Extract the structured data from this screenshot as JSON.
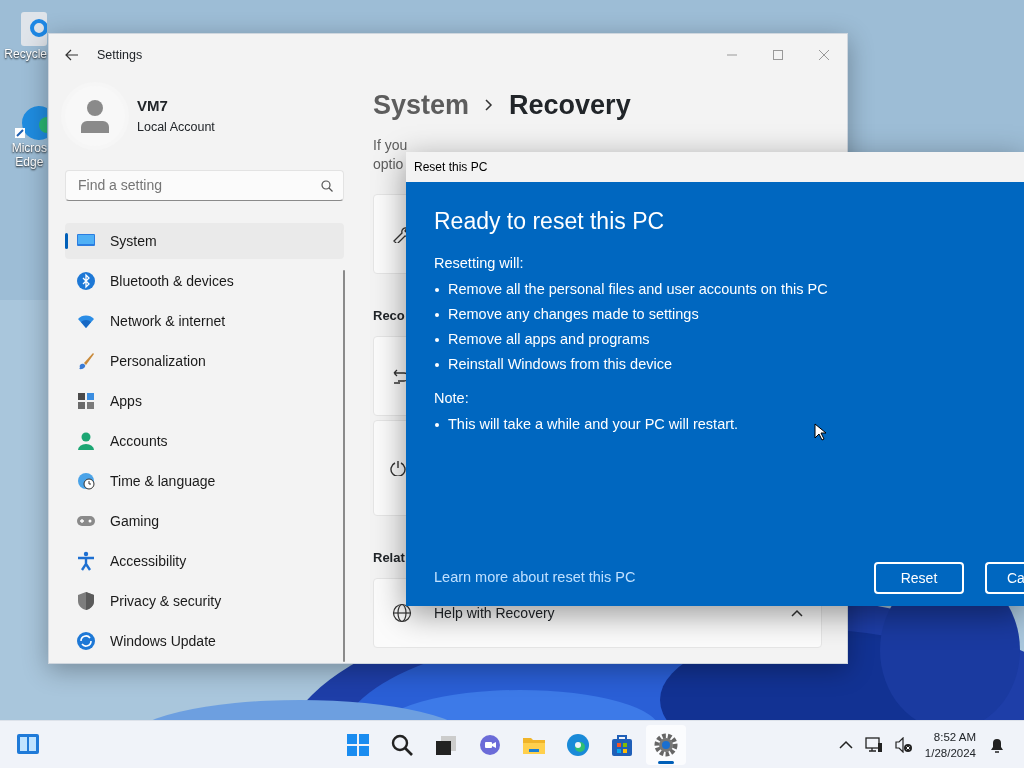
{
  "desktop_icons": [
    {
      "lines": [
        "Recycle"
      ]
    },
    {
      "lines": [
        "Micros",
        "Edge"
      ]
    }
  ],
  "settings_window": {
    "title": "Settings",
    "account": {
      "name": "VM7",
      "type": "Local Account"
    },
    "search": {
      "placeholder": "Find a setting"
    },
    "nav_items": [
      {
        "label": "System",
        "selected": true
      },
      {
        "label": "Bluetooth & devices",
        "selected": false
      },
      {
        "label": "Network & internet",
        "selected": false
      },
      {
        "label": "Personalization",
        "selected": false
      },
      {
        "label": "Apps",
        "selected": false
      },
      {
        "label": "Accounts",
        "selected": false
      },
      {
        "label": "Time & language",
        "selected": false
      },
      {
        "label": "Gaming",
        "selected": false
      },
      {
        "label": "Accessibility",
        "selected": false
      },
      {
        "label": "Privacy & security",
        "selected": false
      },
      {
        "label": "Windows Update",
        "selected": false
      }
    ],
    "breadcrumb": [
      "System",
      "Recovery"
    ],
    "description_lines": [
      "If you",
      "optio"
    ],
    "section_headings": [
      "Reco",
      "Relat"
    ],
    "help_row": {
      "label": "Help with Recovery",
      "expanded": true
    }
  },
  "dialog": {
    "title": "Reset this PC",
    "heading": "Ready to reset this PC",
    "intro": "Resetting will:",
    "bullets": [
      "Remove all the personal files and user accounts on this PC",
      "Remove any changes made to settings",
      "Remove all apps and programs",
      "Reinstall Windows from this device"
    ],
    "note_label": "Note:",
    "note_bullets": [
      "This will take a while and your PC will restart."
    ],
    "link": "Learn more about reset this PC",
    "buttons": [
      "Reset",
      "Ca"
    ]
  },
  "taskbar": {
    "apps": [
      {
        "selected": false
      },
      {
        "selected": false
      },
      {
        "selected": false
      },
      {
        "selected": false
      },
      {
        "selected": false
      },
      {
        "selected": false
      },
      {
        "selected": false
      },
      {
        "selected": true
      }
    ],
    "time": "8:52 AM",
    "date": "1/28/2024"
  }
}
